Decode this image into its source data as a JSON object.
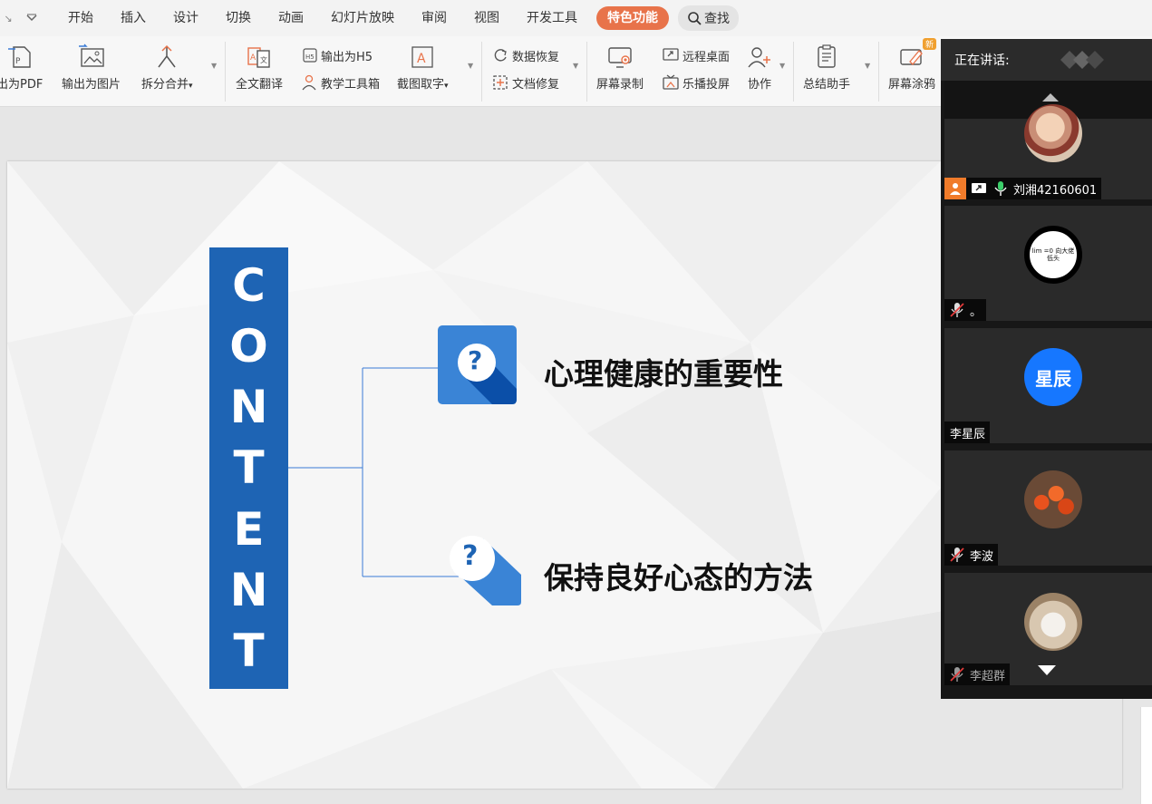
{
  "menubar": {
    "tabs": [
      "开始",
      "插入",
      "设计",
      "切换",
      "动画",
      "幻灯片放映",
      "审阅",
      "视图",
      "开发工具"
    ],
    "special_tab": "特色功能",
    "search_label": "查找"
  },
  "ribbon": {
    "export_pdf": "出为PDF",
    "export_image": "输出为图片",
    "split_merge": "拆分合并",
    "translate": "全文翻译",
    "export_h5": "输出为H5",
    "teaching_tools": "教学工具箱",
    "screenshot_ocr": "截图取字",
    "data_recovery": "数据恢复",
    "doc_repair": "文档修复",
    "screen_record": "屏幕录制",
    "remote_desktop": "远程桌面",
    "cast_screen": "乐播投屏",
    "collaborate": "协作",
    "summary_helper": "总结助手",
    "screen_draw": "屏幕涂鸦",
    "new_badge": "新"
  },
  "slide": {
    "vertical_word": [
      "C",
      "O",
      "N",
      "T",
      "E",
      "N",
      "T"
    ],
    "item1": "心理健康的重要性",
    "item2": "保持良好心态的方法",
    "question_mark": "?"
  },
  "meeting": {
    "speaking_label": "正在讲话:",
    "participants": [
      {
        "name": "刘湘42160601",
        "mic": "on",
        "host": true,
        "sharing": true
      },
      {
        "name": "。",
        "mic": "muted",
        "avatar_text": "lim =0 向大佬低头"
      },
      {
        "name": "李星辰",
        "mic": "none",
        "avatar_text": "星辰",
        "avatar_color": "#1677ff"
      },
      {
        "name": "李波",
        "mic": "muted"
      },
      {
        "name": "李超群",
        "mic": "muted"
      }
    ]
  },
  "colors": {
    "accent": "#e8734a",
    "slide_blue": "#1e64b4",
    "panel_bg": "#171717"
  }
}
